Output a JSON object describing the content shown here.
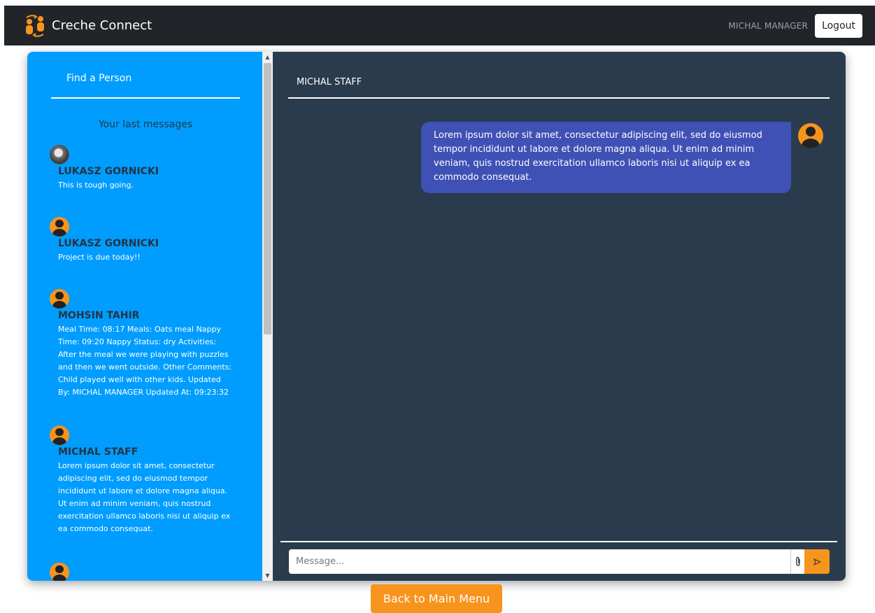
{
  "navbar": {
    "brand": "Creche Connect",
    "user": "MICHAL MANAGER",
    "logout_label": "Logout"
  },
  "sidebar": {
    "find_person": "Find a Person",
    "last_messages_title": "Your last messages",
    "conversations": [
      {
        "name": "LUKASZ GORNICKI",
        "text": "This is tough going.",
        "avatar": "photo-avatar"
      },
      {
        "name": "LUKASZ GORNICKI",
        "text": "Project is due today!!",
        "avatar": "user-icon"
      },
      {
        "name": "MOHSIN TAHIR",
        "text": "Meal Time: 08:17 Meals: Oats meal Nappy Time: 09:20 Nappy Status: dry Activities: After the meal we were playing with puzzles and then we went outside. Other Comments: Child played well with other kids. Updated By: MICHAL MANAGER Updated At: 09:23:32",
        "avatar": "user-icon"
      },
      {
        "name": "MICHAL STAFF",
        "text": "Lorem ipsum dolor sit amet, consectetur adipiscing elit, sed do eiusmod tempor incididunt ut labore et dolore magna aliqua. Ut enim ad minim veniam, quis nostrud exercitation ullamco laboris nisi ut aliquip ex ea commodo consequat.",
        "avatar": "user-icon"
      }
    ]
  },
  "chat": {
    "header": "MICHAL STAFF",
    "messages": [
      {
        "text": "Lorem ipsum dolor sit amet, consectetur adipiscing elit, sed do eiusmod tempor incididunt ut labore et dolore magna aliqua. Ut enim ad minim veniam, quis nostrud exercitation ullamco laboris nisi ut aliquip ex ea commodo consequat."
      }
    ],
    "input_placeholder": "Message...",
    "attach_icon": "paperclip-icon",
    "send_icon": "send-icon"
  },
  "back_button": "Back to Main Menu",
  "colors": {
    "navbar": "#212529",
    "sidebar": "#009dff",
    "chat_bg": "#2a3b4d",
    "bubble": "#3f51b5",
    "accent": "#f7941d"
  }
}
